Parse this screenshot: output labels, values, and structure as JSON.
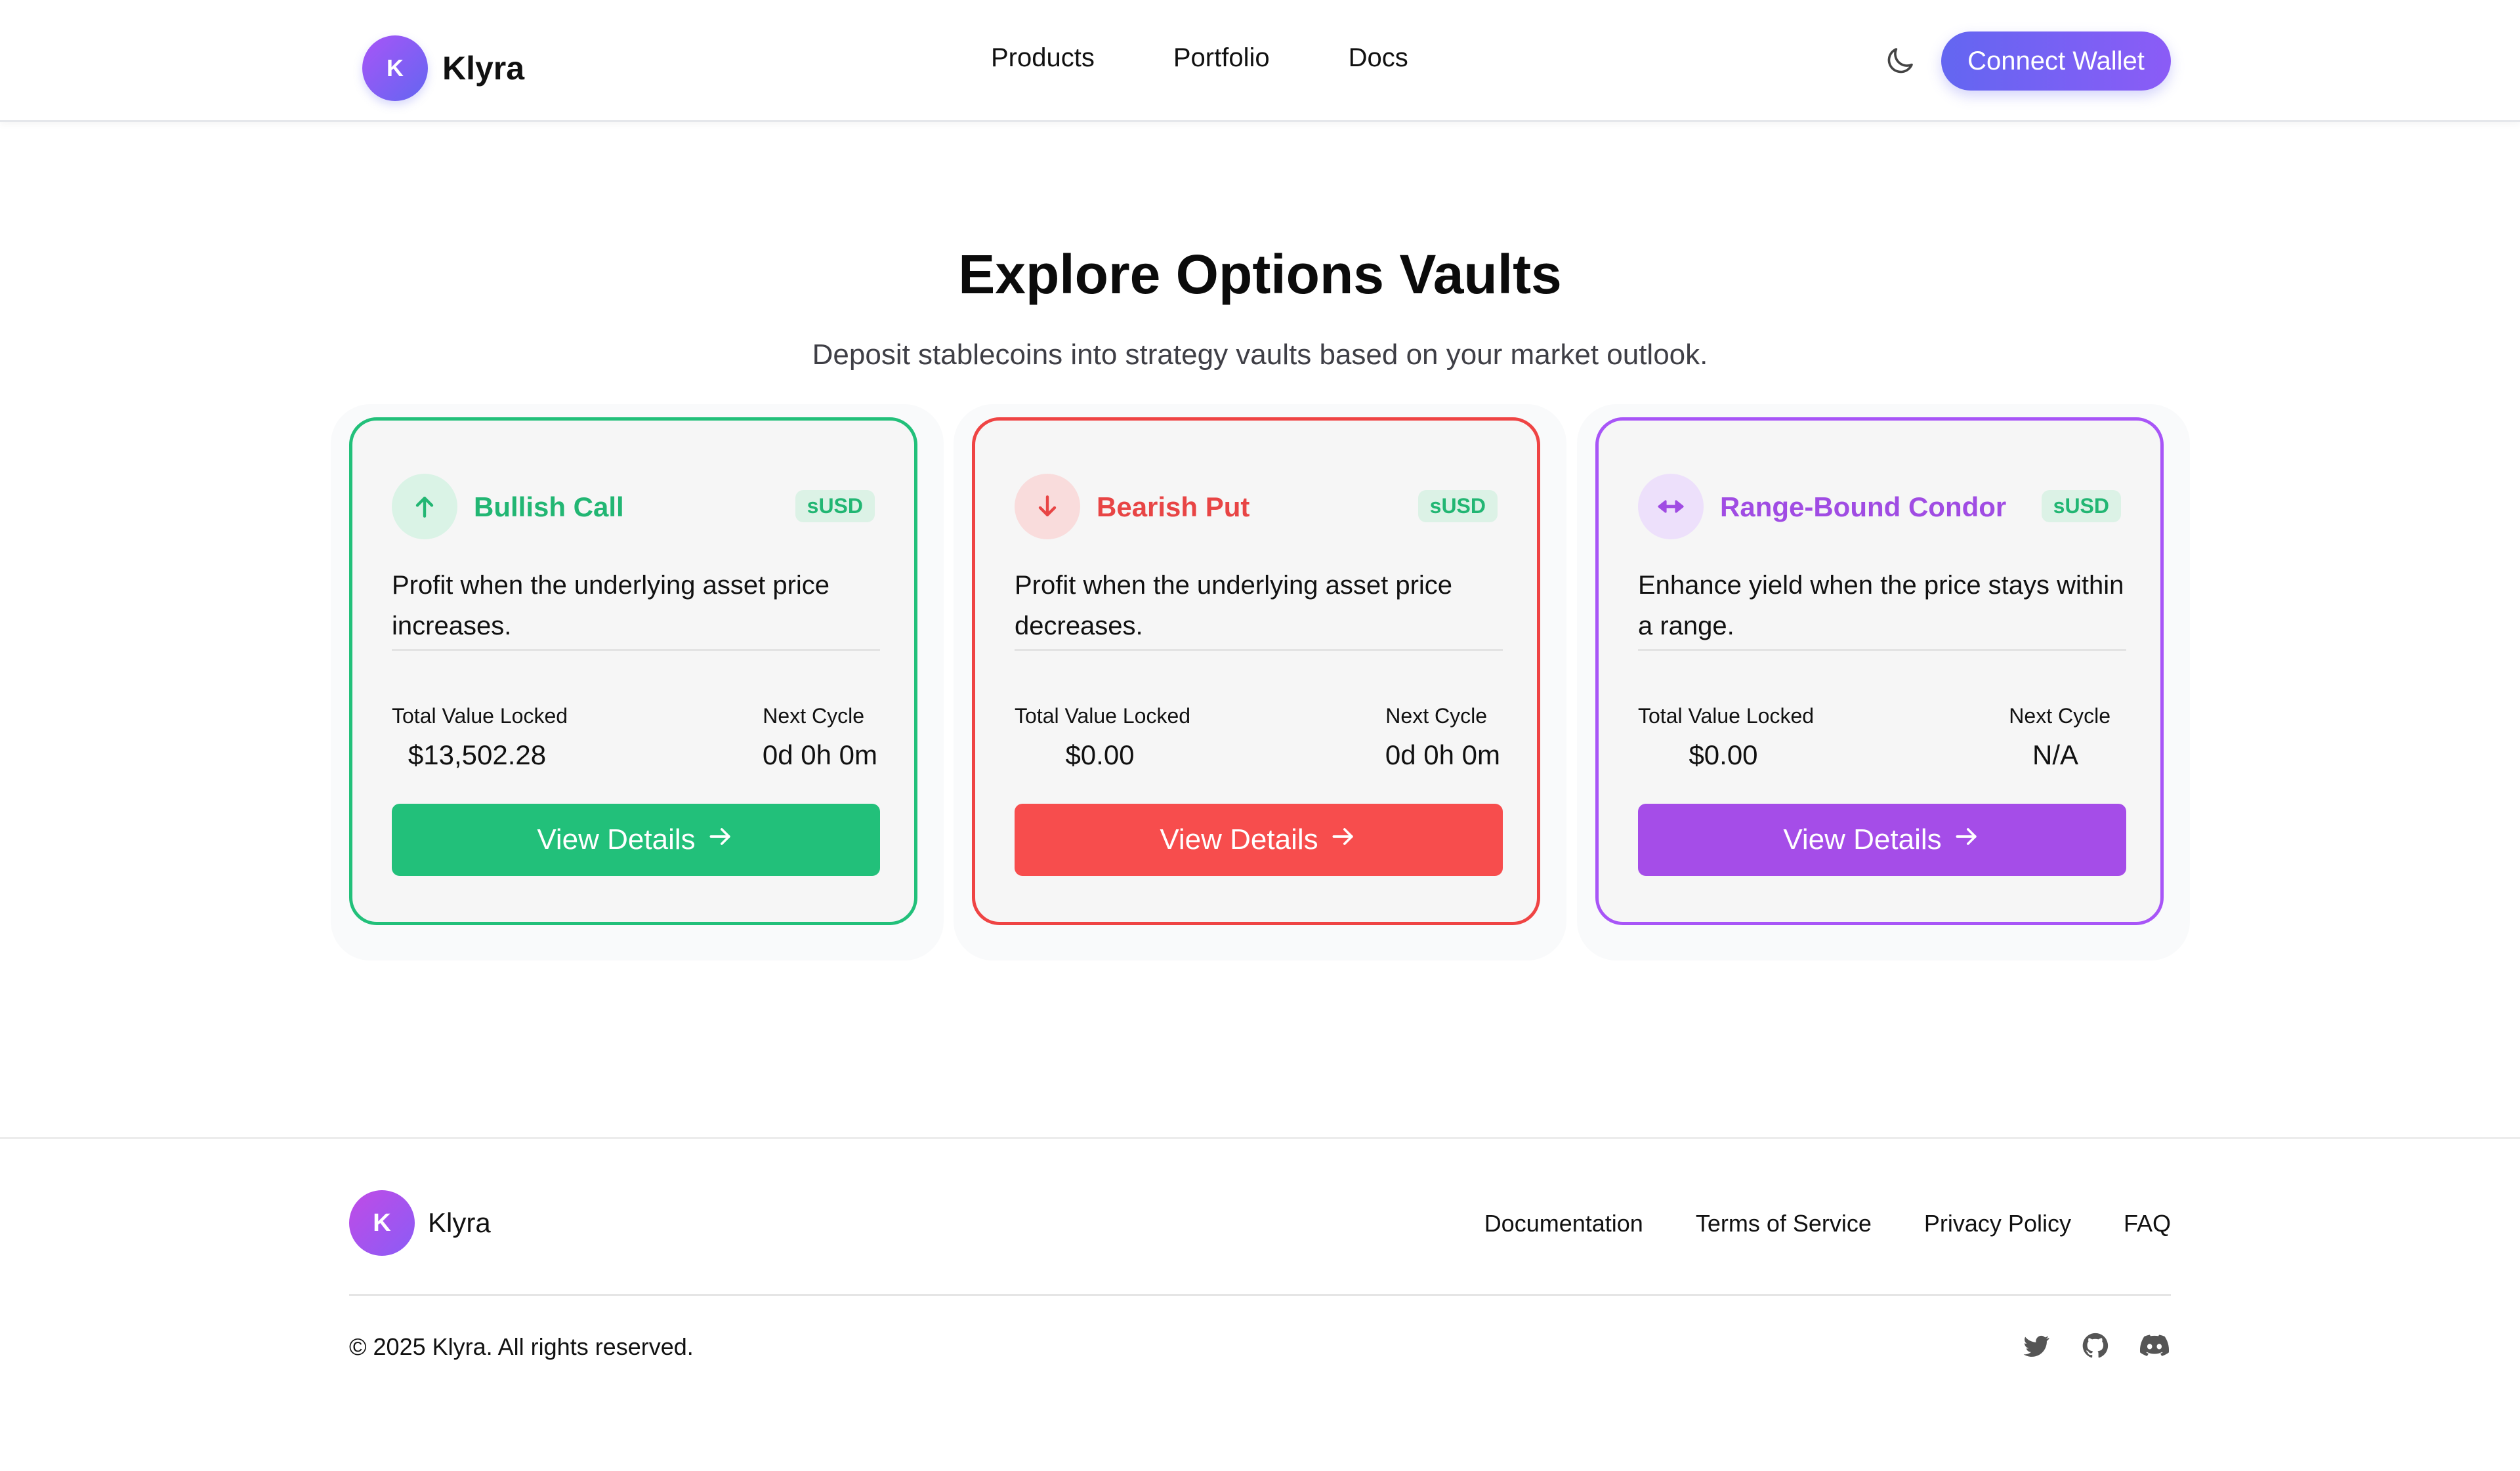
{
  "header": {
    "brand_initial": "K",
    "brand_name": "Klyra",
    "nav": [
      "Products",
      "Portfolio",
      "Docs"
    ],
    "theme_icon": "moon-icon",
    "connect_label": "Connect Wallet"
  },
  "hero": {
    "title": "Explore Options Vaults",
    "subtitle": "Deposit stablecoins into strategy vaults based on your market outlook."
  },
  "vaults": [
    {
      "icon": "arrow-up-icon",
      "title": "Bullish Call",
      "badge": "sUSD",
      "description": "Profit when the underlying asset price increases.",
      "tvl_label": "Total Value Locked",
      "tvl_value": "$13,502.28",
      "cycle_label": "Next Cycle",
      "cycle_value": "0d 0h 0m",
      "button_label": "View Details",
      "accent": "#22c07a"
    },
    {
      "icon": "arrow-down-icon",
      "title": "Bearish Put",
      "badge": "sUSD",
      "description": "Profit when the underlying asset price decreases.",
      "tvl_label": "Total Value Locked",
      "tvl_value": "$0.00",
      "cycle_label": "Next Cycle",
      "cycle_value": "0d 0h 0m",
      "button_label": "View Details",
      "accent": "#f74d4d"
    },
    {
      "icon": "arrows-left-right-icon",
      "title": "Range-Bound Condor",
      "badge": "sUSD",
      "description": "Enhance yield when the price stays within a range.",
      "tvl_label": "Total Value Locked",
      "tvl_value": "$0.00",
      "cycle_label": "Next Cycle",
      "cycle_value": "N/A",
      "button_label": "View Details",
      "accent": "#a54de8"
    }
  ],
  "footer": {
    "brand_initial": "K",
    "brand_name": "Klyra",
    "links": [
      "Documentation",
      "Terms of Service",
      "Privacy Policy",
      "FAQ"
    ],
    "copyright": "© 2025 Klyra. All rights reserved.",
    "socials": [
      "twitter-icon",
      "github-icon",
      "discord-icon"
    ]
  }
}
